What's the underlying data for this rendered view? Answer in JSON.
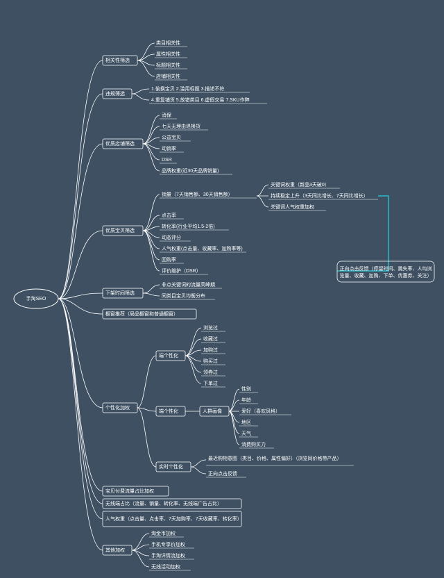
{
  "root": "手淘SEO",
  "annotation": "正向点击反馈（停留时间、跳失率、人均浏览量、收藏、加购、下单、优惠券、关注）",
  "nodes": {
    "l1": [
      "相关性筛选",
      "违规筛选",
      "优质店铺筛选",
      "优质宝贝筛选",
      "下架时间筛选",
      "橱窗推荐（局品橱窗和普通橱窗）",
      "个性化加权",
      "宝贝付费流量占比加权",
      "无线端占比（流量、销量、转化率、无线端广告占比）",
      "人气权重（点击量、点击率、7天加购率、7天收藏率、转化率）",
      "其他加权"
    ],
    "l2_rel": [
      "类目相关性",
      "属性相关性",
      "标题相关性",
      "店铺相关性"
    ],
    "l2_vio": [
      "1.偷换宝贝 2.滥用标题 3.描述不符",
      "4.重复铺货 5.放错类目 6.虚假交易 7.SKU作弊"
    ],
    "l2_shop": [
      "消保",
      "七天无理由退换货",
      "公益宝贝",
      "动销率",
      "DSR",
      "品牌权重(近30天品牌销量)"
    ],
    "l2_item": [
      "销量（7天销售额、30天销售额）",
      "点击率",
      "转化率(行业平均1.5-2倍)",
      "动态评分",
      "人气权重(点击量、收藏率、加购率等)",
      "回购率",
      "评价维护（DSR）"
    ],
    "l3_sales": [
      "关键词权重（新品3天破0）",
      "持续稳定上升（3天同比增长、7天同比增长）",
      "关键词人气权重加权"
    ],
    "l2_down": [
      "非点关键词的流量高峰期",
      "同类目宝贝均衡分布"
    ],
    "l2_pers": [
      "端个性化",
      "端个性化",
      "实时个性化"
    ],
    "l3_p1": [
      "浏览过",
      "收藏过",
      "加购过",
      "购买过",
      "领券过",
      "下单过"
    ],
    "l3_p2_label": "人群画像",
    "l3_p2": [
      "性别",
      "年龄",
      "爱好（喜欢风格）",
      "地区",
      "天气",
      "消费购买力"
    ],
    "l3_p3": [
      "最近购物意图（类目、价格、属性偏好）（浏览同价格带产品）",
      "正向点击反馈"
    ],
    "l2_other": [
      "淘金币加权",
      "手机专享价加权",
      "手淘详情流加权",
      "无线活动加权"
    ]
  }
}
